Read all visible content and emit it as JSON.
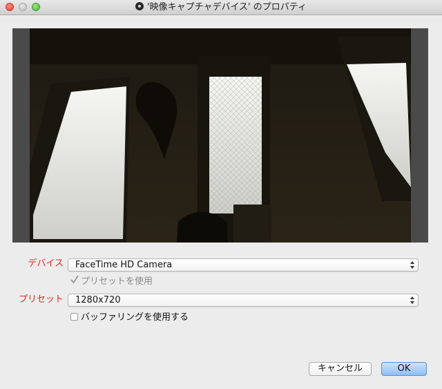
{
  "window": {
    "title": "'映像キャプチャデバイス' のプロパティ"
  },
  "preview": {
    "description_icon": "camera-preview"
  },
  "form": {
    "device": {
      "label": "デバイス",
      "value": "FaceTime HD Camera"
    },
    "use_preset": {
      "label": "プリセットを使用",
      "checked": true,
      "enabled": false
    },
    "preset": {
      "label": "プリセット",
      "value": "1280x720"
    },
    "use_buffering": {
      "label": "バッファリングを使用する",
      "checked": false
    }
  },
  "buttons": {
    "cancel": "キャンセル",
    "ok": "OK"
  },
  "colors": {
    "label_red": "#e12525",
    "ok_blue": "#8fbdf2"
  }
}
